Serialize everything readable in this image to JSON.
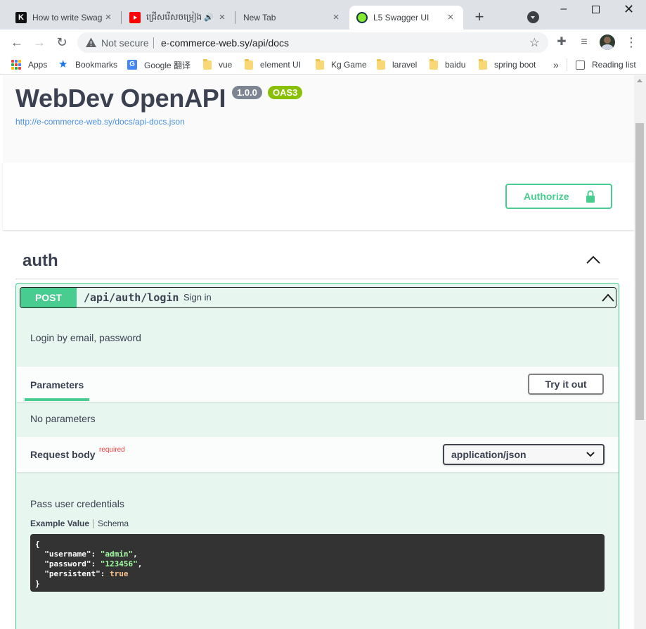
{
  "browser": {
    "tabs": [
      {
        "title": "How to write Swagger",
        "favicon": "k-letter-icon",
        "active": false
      },
      {
        "title": "ជ្រើសរើសចម្រៀង",
        "favicon": "youtube-icon",
        "active": false,
        "audio": true
      },
      {
        "title": "New Tab",
        "favicon": "",
        "active": false
      },
      {
        "title": "L5 Swagger UI",
        "favicon": "swagger-icon",
        "active": true
      }
    ],
    "omnibox": {
      "security_label": "Not secure",
      "url": "e-commerce-web.sy/api/docs"
    },
    "bookmarks": [
      {
        "label": "Apps",
        "icon": "apps-grid-icon"
      },
      {
        "label": "Bookmarks",
        "icon": "star-icon"
      },
      {
        "label": "Google 翻译",
        "icon": "google-translate-icon"
      },
      {
        "label": "vue",
        "icon": "folder-icon"
      },
      {
        "label": "element UI",
        "icon": "folder-icon"
      },
      {
        "label": "Kg Game",
        "icon": "folder-icon"
      },
      {
        "label": "laravel",
        "icon": "folder-icon"
      },
      {
        "label": "baidu",
        "icon": "folder-icon"
      },
      {
        "label": "spring boot",
        "icon": "folder-icon"
      }
    ],
    "overflow_label": "»",
    "reading_list_label": "Reading list"
  },
  "swagger": {
    "title": "WebDev OpenAPI",
    "version": "1.0.0",
    "oas_badge": "OAS3",
    "spec_url": "http://e-commerce-web.sy/docs/api-docs.json",
    "authorize_label": "Authorize",
    "tag": {
      "name": "auth",
      "operation": {
        "method": "POST",
        "path": "/api/auth/login",
        "summary": "Sign in",
        "description": "Login by email, password",
        "parameters_title": "Parameters",
        "try_label": "Try it out",
        "no_params": "No parameters",
        "request_body_title": "Request body",
        "required_label": "required",
        "content_type": "application/json",
        "body_description": "Pass user credentials",
        "example_tab": "Example Value",
        "schema_tab": "Schema",
        "example": {
          "open": "{",
          "username_key": "\"username\"",
          "username_val": "\"admin\"",
          "password_key": "\"password\"",
          "password_val": "\"123456\"",
          "persistent_key": "\"persistent\"",
          "persistent_val": "true",
          "close": "}"
        }
      }
    }
  },
  "colors": {
    "post_green": "#49cc90",
    "title_text": "#3b4151",
    "link_blue": "#4990e2",
    "version_badge": "#7d8492",
    "oas_badge": "#89bf04",
    "required_red": "#f93e3e"
  }
}
